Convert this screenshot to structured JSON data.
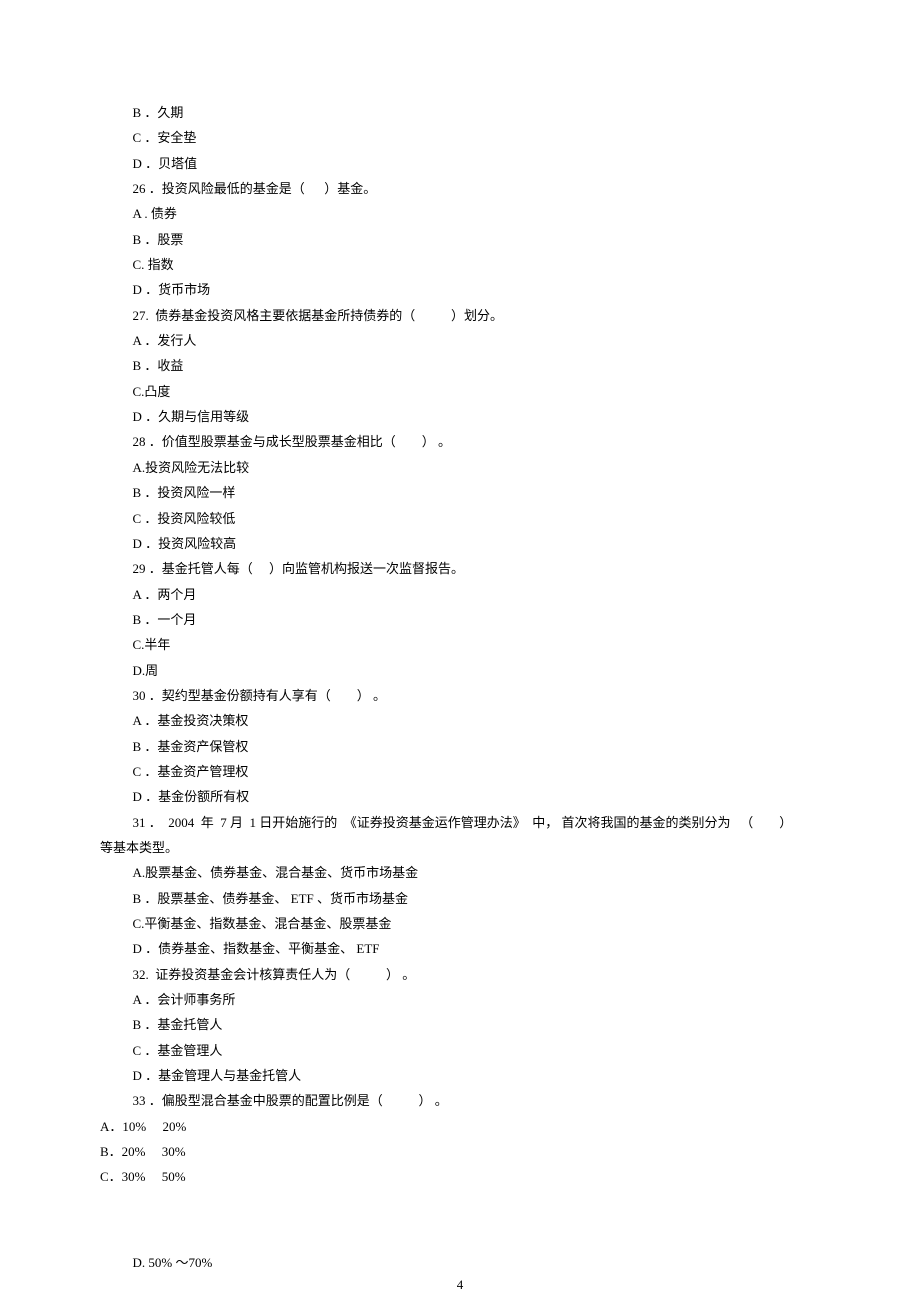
{
  "q25": {
    "B": "B ．久期",
    "C": "C ．安全垫",
    "D": "D ．贝塔值"
  },
  "q26": {
    "stem": "26 ．投资风险最低的基金是（      ）基金。",
    "A": "A . 债券",
    "B": "B ．股票",
    "C": "C. 指数",
    "D": "D ．货币市场"
  },
  "q27": {
    "stem": "27.  债券基金投资风格主要依据基金所持债券的（           ）划分。",
    "A": "A ．发行人",
    "B": "B ．收益",
    "C": "C.凸度",
    "D": "D ．久期与信用等级"
  },
  "q28": {
    "stem": "28 ．价值型股票基金与成长型股票基金相比（        ） 。",
    "A": "A.投资风险无法比较",
    "B": "B ．投资风险一样",
    "C": "C ．投资风险较低",
    "D": "D ．投资风险较高"
  },
  "q29": {
    "stem": "29 ．基金托管人每（     ）向监管机构报送一次监督报告。",
    "A": "A ．两个月",
    "B": "B ．一个月",
    "C": "C.半年",
    "D": "D.周"
  },
  "q30": {
    "stem": "30 ．契约型基金份额持有人享有（        ） 。",
    "A": "A ．基金投资决策权",
    "B": "B ．基金资产保管权",
    "C": "C ．基金资产管理权",
    "D": "D ．基金份额所有权"
  },
  "q31": {
    "stem_line1": "31 ．  2004  年  7 月  1 日开始施行的  《证券投资基金运作管理办法》  中， 首次将我国的基金的类别分为   （        ）",
    "stem_line2": "等基本类型。",
    "A": "A.股票基金、债券基金、混合基金、货币市场基金",
    "B": "B ．股票基金、债券基金、 ETF 、货币市场基金",
    "C": "C.平衡基金、指数基金、混合基金、股票基金",
    "D": "D ．债券基金、指数基金、平衡基金、 ETF"
  },
  "q32": {
    "stem": "32.  证券投资基金会计核算责任人为（           ） 。",
    "A": "A ．会计师事务所",
    "B": "B ．基金托管人",
    "C": "C ．基金管理人",
    "D": "D ．基金管理人与基金托管人"
  },
  "q33": {
    "stem": "33 ．偏股型混合基金中股票的配置比例是（           ） 。",
    "A": "A．10%     20%",
    "B": "B．20%     30%",
    "C": "C．30%     50%",
    "D": "D. 50% 〜70%"
  },
  "page_number": "4"
}
